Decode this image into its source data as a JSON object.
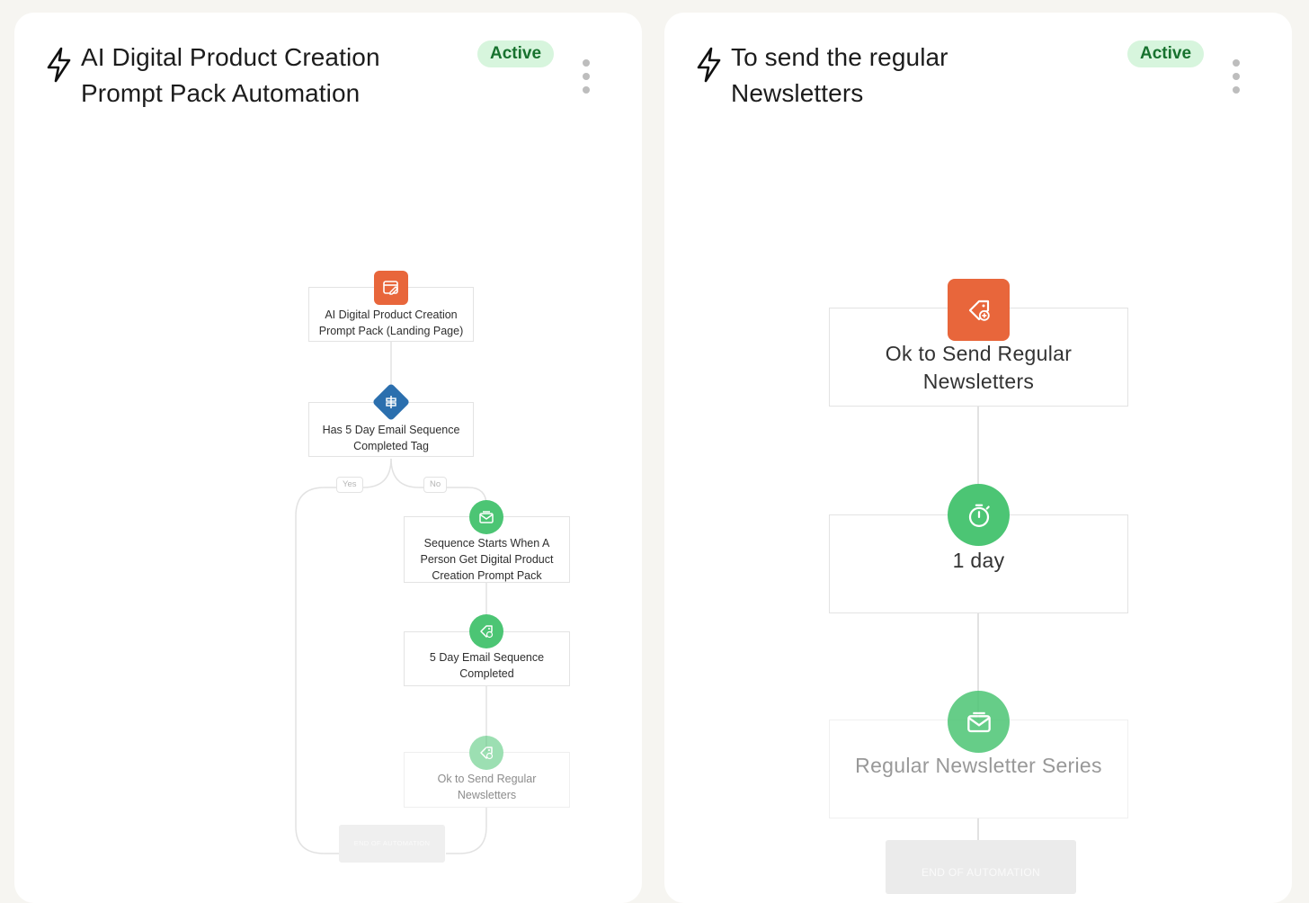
{
  "cards": [
    {
      "title_line1": "AI Digital Product Creation",
      "title_line2": "Prompt Pack Automation",
      "status": "Active",
      "trigger": {
        "label_line1": "AI Digital Product Creation",
        "label_line2": "Prompt Pack (Landing Page)",
        "icon": "form-edit-icon",
        "color": "#e8663b"
      },
      "condition": {
        "label_line1": "Has 5 Day Email Sequence",
        "label_line2": "Completed Tag",
        "icon": "split-icon",
        "color": "#2b6fae"
      },
      "branch_yes": "Yes",
      "branch_no": "No",
      "steps": [
        {
          "label_line1": "Sequence Starts When A",
          "label_line2": "Person Get Digital Product",
          "label_line3": "Creation Prompt Pack",
          "icon": "envelope-icon"
        },
        {
          "label_line1": "5 Day Email Sequence",
          "label_line2": "Completed",
          "icon": "tag-add-icon"
        },
        {
          "label_line1": "Ok to Send Regular",
          "label_line2": "Newsletters",
          "icon": "tag-add-icon"
        }
      ],
      "end_label": "END OF AUTOMATION"
    },
    {
      "title_line1": "To send the regular",
      "title_line2": "Newsletters",
      "status": "Active",
      "trigger": {
        "label_line1": "Ok to Send Regular",
        "label_line2": "Newsletters",
        "icon": "tag-add-icon",
        "color": "#e8663b"
      },
      "delay": {
        "label": "1 day",
        "icon": "stopwatch-icon"
      },
      "email": {
        "label": "Regular Newsletter Series",
        "icon": "envelope-icon"
      },
      "end_label": "END OF AUTOMATION"
    }
  ],
  "colors": {
    "green": "#4cc574",
    "orange": "#e8663b",
    "blue": "#2b6fae",
    "badge_bg": "#d7f5dd",
    "badge_text": "#17722e"
  }
}
